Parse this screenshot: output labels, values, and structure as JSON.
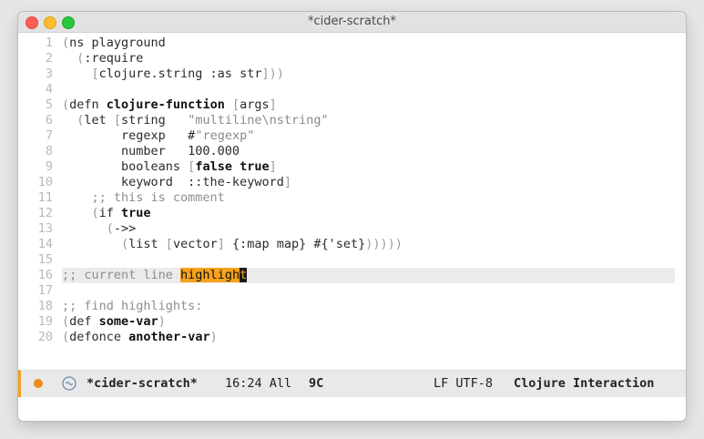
{
  "window": {
    "title": "*cider-scratch*"
  },
  "editor": {
    "lines": [
      {
        "n": "1",
        "tokens": [
          [
            "(",
            "p"
          ],
          [
            "ns playground",
            "k"
          ]
        ]
      },
      {
        "n": "2",
        "tokens": [
          [
            "  (",
            "p"
          ],
          [
            ":require",
            "k"
          ]
        ]
      },
      {
        "n": "3",
        "tokens": [
          [
            "    [",
            "p"
          ],
          [
            "clojure.string :as str",
            "k"
          ],
          [
            "]))",
            "p"
          ]
        ]
      },
      {
        "n": "4",
        "tokens": []
      },
      {
        "n": "5",
        "tokens": [
          [
            "(",
            "p"
          ],
          [
            "defn ",
            "k"
          ],
          [
            "clojure-function",
            "b"
          ],
          [
            " [",
            "p"
          ],
          [
            "args",
            "k"
          ],
          [
            "]",
            "p"
          ]
        ]
      },
      {
        "n": "6",
        "tokens": [
          [
            "  (",
            "p"
          ],
          [
            "let ",
            "k"
          ],
          [
            "[",
            "p"
          ],
          [
            "string   ",
            "k"
          ],
          [
            "\"multiline\\nstring\"",
            "s"
          ]
        ]
      },
      {
        "n": "7",
        "tokens": [
          [
            "        regexp   #",
            "k"
          ],
          [
            "\"regexp\"",
            "s"
          ]
        ]
      },
      {
        "n": "8",
        "tokens": [
          [
            "        number   100.000",
            "k"
          ]
        ]
      },
      {
        "n": "9",
        "tokens": [
          [
            "        booleans ",
            "k"
          ],
          [
            "[",
            "p"
          ],
          [
            "false true",
            "b"
          ],
          [
            "]",
            "p"
          ]
        ]
      },
      {
        "n": "10",
        "tokens": [
          [
            "        keyword  ::the-keyword",
            "k"
          ],
          [
            "]",
            "p"
          ]
        ]
      },
      {
        "n": "11",
        "tokens": [
          [
            "    ;; this is comment",
            "c"
          ]
        ]
      },
      {
        "n": "12",
        "tokens": [
          [
            "    (",
            "p"
          ],
          [
            "if ",
            "k"
          ],
          [
            "true",
            "b"
          ]
        ]
      },
      {
        "n": "13",
        "tokens": [
          [
            "      (",
            "p"
          ],
          [
            "->>",
            "k"
          ]
        ]
      },
      {
        "n": "14",
        "tokens": [
          [
            "        (",
            "p"
          ],
          [
            "list ",
            "k"
          ],
          [
            "[",
            "p"
          ],
          [
            "vector",
            "k"
          ],
          [
            "]",
            "p"
          ],
          [
            " {:map map} #{'set}",
            "k"
          ],
          [
            ")))))",
            "p"
          ]
        ]
      },
      {
        "n": "15",
        "tokens": []
      },
      {
        "n": "16",
        "current": true,
        "tokens": [
          [
            ";; current line ",
            "c"
          ],
          [
            "highligh",
            "h"
          ],
          [
            "t",
            "x"
          ]
        ]
      },
      {
        "n": "17",
        "tokens": []
      },
      {
        "n": "18",
        "tokens": [
          [
            ";; find highlights:",
            "c"
          ]
        ]
      },
      {
        "n": "19",
        "tokens": [
          [
            "(",
            "p"
          ],
          [
            "def ",
            "k"
          ],
          [
            "some-var",
            "b"
          ],
          [
            ")",
            "p"
          ]
        ]
      },
      {
        "n": "20",
        "tokens": [
          [
            "(",
            "p"
          ],
          [
            "defonce ",
            "k"
          ],
          [
            "another-var",
            "b"
          ],
          [
            ")",
            "p"
          ]
        ]
      }
    ]
  },
  "modeline": {
    "buffer": "*cider-scratch*",
    "position": "16:24 All",
    "column": "9C",
    "encoding": "LF UTF-8",
    "mode": "Clojure Interaction",
    "accent_color": "#f3a21e"
  }
}
